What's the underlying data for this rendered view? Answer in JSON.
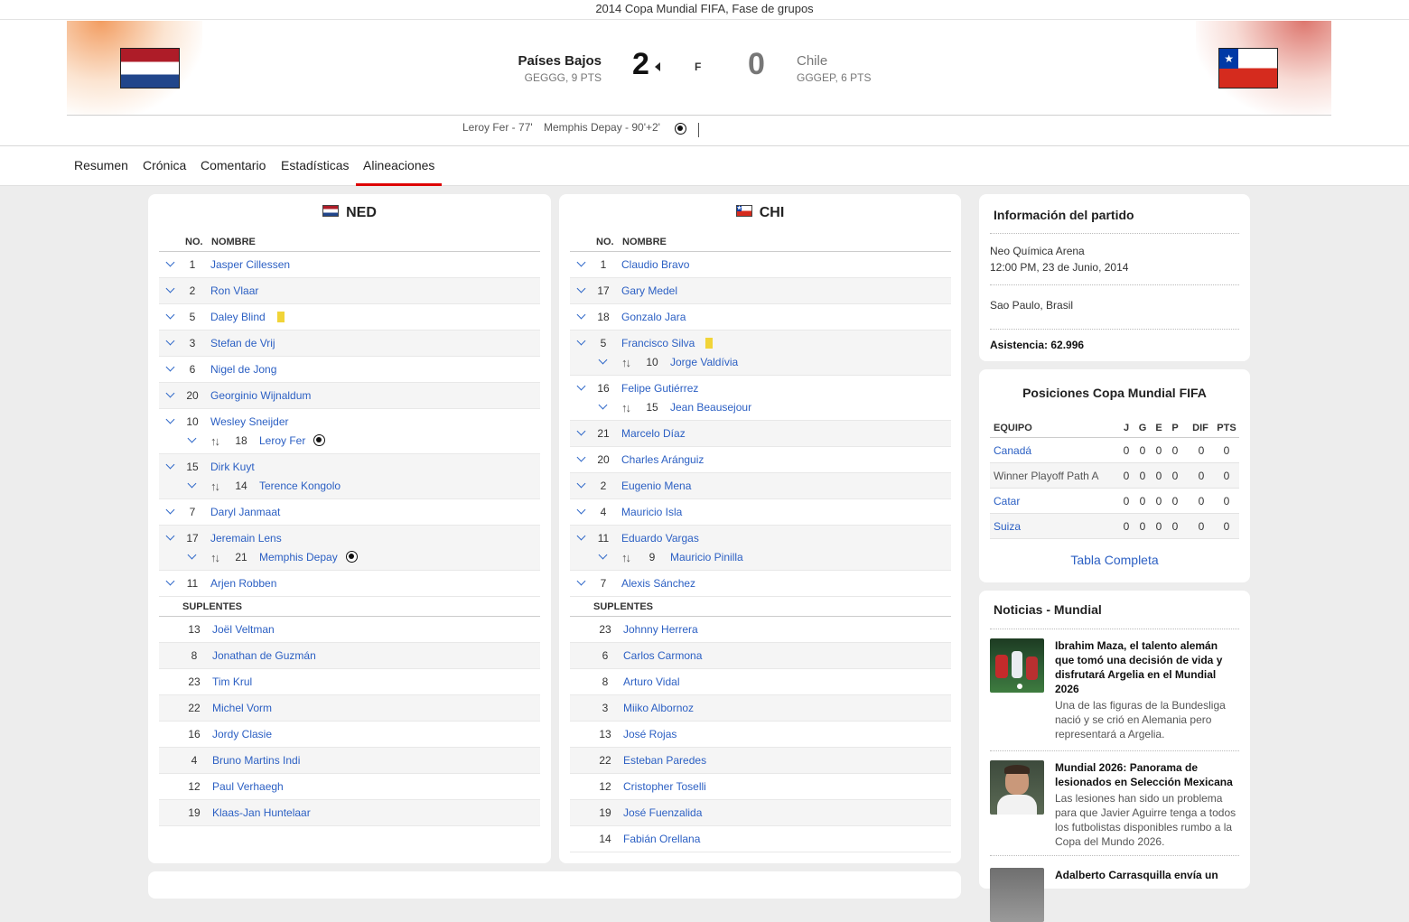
{
  "header": {
    "competition": "2014 Copa Mundial FIFA, Fase de grupos",
    "home": {
      "name": "Países Bajos",
      "record": "GEGGG, 9 PTS",
      "score": "2"
    },
    "away": {
      "name": "Chile",
      "record": "GGGEP, 6 PTS",
      "score": "0"
    },
    "status": "F",
    "scorers": [
      "Leroy Fer - 77'",
      "Memphis Depay - 90'+2'"
    ]
  },
  "tabs": [
    "Resumen",
    "Crónica",
    "Comentario",
    "Estadísticas",
    "Alineaciones"
  ],
  "lineups": {
    "col_no": "NO.",
    "col_name": "NOMBRE",
    "subs_label": "SUPLENTES",
    "ned": {
      "code": "NED",
      "starters": [
        {
          "no": "1",
          "name": "Jasper Cillessen"
        },
        {
          "no": "2",
          "name": "Ron Vlaar"
        },
        {
          "no": "5",
          "name": "Daley Blind"
        },
        {
          "no": "3",
          "name": "Stefan de Vrij"
        },
        {
          "no": "6",
          "name": "Nigel de Jong"
        },
        {
          "no": "20",
          "name": "Georginio Wijnaldum"
        },
        {
          "no": "10",
          "name": "Wesley Sneijder",
          "sub_no": "18",
          "sub_name": "Leroy Fer"
        },
        {
          "no": "15",
          "name": "Dirk Kuyt",
          "sub_no": "14",
          "sub_name": "Terence Kongolo"
        },
        {
          "no": "7",
          "name": "Daryl Janmaat"
        },
        {
          "no": "17",
          "name": "Jeremain Lens",
          "sub_no": "21",
          "sub_name": "Memphis Depay"
        },
        {
          "no": "11",
          "name": "Arjen Robben"
        }
      ],
      "subs": [
        {
          "no": "13",
          "name": "Joël Veltman"
        },
        {
          "no": "8",
          "name": "Jonathan de Guzmán"
        },
        {
          "no": "23",
          "name": "Tim Krul"
        },
        {
          "no": "22",
          "name": "Michel Vorm"
        },
        {
          "no": "16",
          "name": "Jordy Clasie"
        },
        {
          "no": "4",
          "name": "Bruno Martins Indi"
        },
        {
          "no": "12",
          "name": "Paul Verhaegh"
        },
        {
          "no": "19",
          "name": "Klaas-Jan Huntelaar"
        }
      ]
    },
    "chi": {
      "code": "CHI",
      "starters": [
        {
          "no": "1",
          "name": "Claudio Bravo"
        },
        {
          "no": "17",
          "name": "Gary Medel"
        },
        {
          "no": "18",
          "name": "Gonzalo Jara"
        },
        {
          "no": "5",
          "name": "Francisco Silva",
          "sub_no": "10",
          "sub_name": "Jorge Valdívia"
        },
        {
          "no": "16",
          "name": "Felipe Gutiérrez",
          "sub_no": "15",
          "sub_name": "Jean Beausejour"
        },
        {
          "no": "21",
          "name": "Marcelo Díaz"
        },
        {
          "no": "20",
          "name": "Charles Aránguiz"
        },
        {
          "no": "2",
          "name": "Eugenio Mena"
        },
        {
          "no": "4",
          "name": "Mauricio Isla"
        },
        {
          "no": "11",
          "name": "Eduardo Vargas",
          "sub_no": "9",
          "sub_name": "Mauricio Pinilla"
        },
        {
          "no": "7",
          "name": "Alexis Sánchez"
        }
      ],
      "subs": [
        {
          "no": "23",
          "name": "Johnny Herrera"
        },
        {
          "no": "6",
          "name": "Carlos Carmona"
        },
        {
          "no": "8",
          "name": "Arturo Vidal"
        },
        {
          "no": "3",
          "name": "Miiko Albornoz"
        },
        {
          "no": "13",
          "name": "José Rojas"
        },
        {
          "no": "22",
          "name": "Esteban Paredes"
        },
        {
          "no": "12",
          "name": "Cristopher Toselli"
        },
        {
          "no": "19",
          "name": "José Fuenzalida"
        },
        {
          "no": "14",
          "name": "Fabián Orellana"
        }
      ]
    }
  },
  "match_info": {
    "title": "Información del partido",
    "stadium": "Neo Química Arena",
    "datetime": "12:00 PM, 23 de Junio, 2014",
    "location": "Sao Paulo, Brasil",
    "attendance": "Asistencia: 62.996"
  },
  "standings": {
    "title": "Posiciones Copa Mundial FIFA",
    "columns": [
      "EQUIPO",
      "J",
      "G",
      "E",
      "P",
      "DIF",
      "PTS"
    ],
    "rows": [
      {
        "team": "Canadá",
        "vals": [
          "0",
          "0",
          "0",
          "0",
          "0",
          "0"
        ],
        "link": true
      },
      {
        "team": "Winner Playoff Path A",
        "vals": [
          "0",
          "0",
          "0",
          "0",
          "0",
          "0"
        ],
        "link": false
      },
      {
        "team": "Catar",
        "vals": [
          "0",
          "0",
          "0",
          "0",
          "0",
          "0"
        ],
        "link": true
      },
      {
        "team": "Suiza",
        "vals": [
          "0",
          "0",
          "0",
          "0",
          "0",
          "0"
        ],
        "link": true
      }
    ],
    "full_table_link": "Tabla Completa"
  },
  "news": {
    "title": "Noticias - Mundial",
    "items": [
      {
        "headline": "Ibrahim Maza, el talento alemán que tomó una decisión de vida y disfrutará Argelia en el Mundial 2026",
        "summary": "Una de las figuras de la Bundesliga nació y se crió en Alemania pero representará a Argelia."
      },
      {
        "headline": "Mundial 2026: Panorama de lesionados en Selección Mexicana",
        "summary": "Las lesiones han sido un problema para que Javier Aguirre tenga a todos los futbolistas disponibles rumbo a la Copa del Mundo 2026."
      },
      {
        "headline": "Adalberto Carrasquilla envía un",
        "summary": ""
      }
    ]
  },
  "colors": {
    "link": "#2b5fc3",
    "active_tab": "#dd0000",
    "yellow_card": "#f1d438"
  }
}
